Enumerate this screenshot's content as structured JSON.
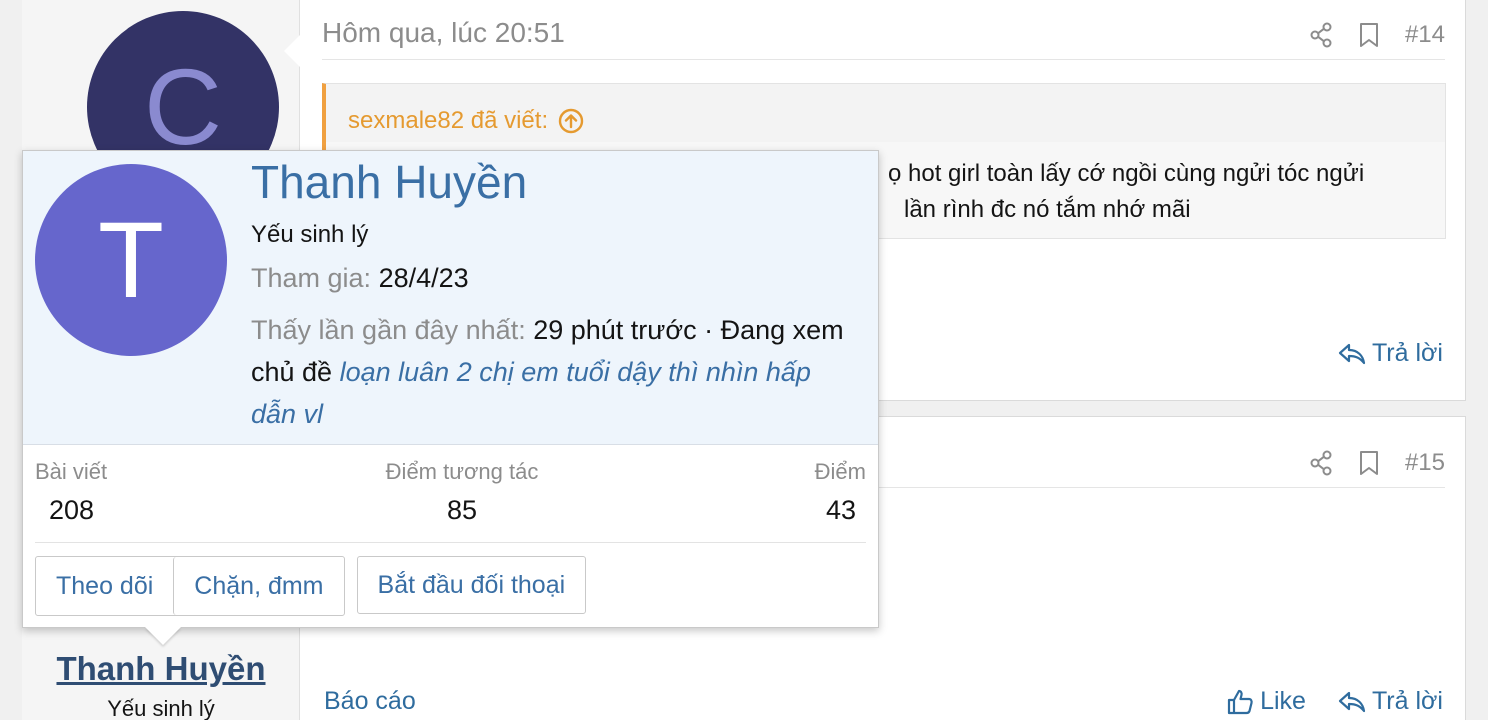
{
  "previous_poster": {
    "avatar_letter": "C",
    "avatar_color": "#333366"
  },
  "post1": {
    "date": "Hôm qua, lúc 20:51",
    "number": "#14",
    "quote": {
      "author_line": "sexmale82 đã viết:",
      "line1": "ọ hot girl toàn lấy cớ ngồi cùng ngửi tóc ngửi",
      "line2": "lần rình đc nó tắm nhớ mãi"
    },
    "reply_label": "Trả lời"
  },
  "post2": {
    "number": "#15",
    "report_label": "Báo cáo",
    "like_label": "Like",
    "reply_label": "Trả lời"
  },
  "poster": {
    "name": "Thanh Huyền",
    "title": "Yếu sinh lý"
  },
  "tooltip": {
    "avatar_letter": "T",
    "avatar_color": "#6666cc",
    "name": "Thanh Huyền",
    "title": "Yếu sinh lý",
    "joined_label": "Tham gia:",
    "joined_value": "28/4/23",
    "last_seen_label": "Thấy lần gần đây nhất:",
    "last_seen_value": "29 phút trước · Đang xem chủ đề",
    "viewing_thread": "loạn luân 2 chị em tuổi dậy thì nhìn hấp dẫn vl",
    "stats": {
      "posts_label": "Bài viết",
      "posts_value": "208",
      "reactions_label": "Điểm tương tác",
      "reactions_value": "85",
      "points_label": "Điểm",
      "points_value": "43"
    },
    "buttons": {
      "follow": "Theo dõi",
      "block": "Chặn, đmm",
      "start_conversation": "Bắt đầu đối thoại"
    }
  },
  "colors": {
    "link": "#2f6c9e",
    "quote_accent": "#f0a040",
    "tooltip_bg": "#eef5fc"
  }
}
